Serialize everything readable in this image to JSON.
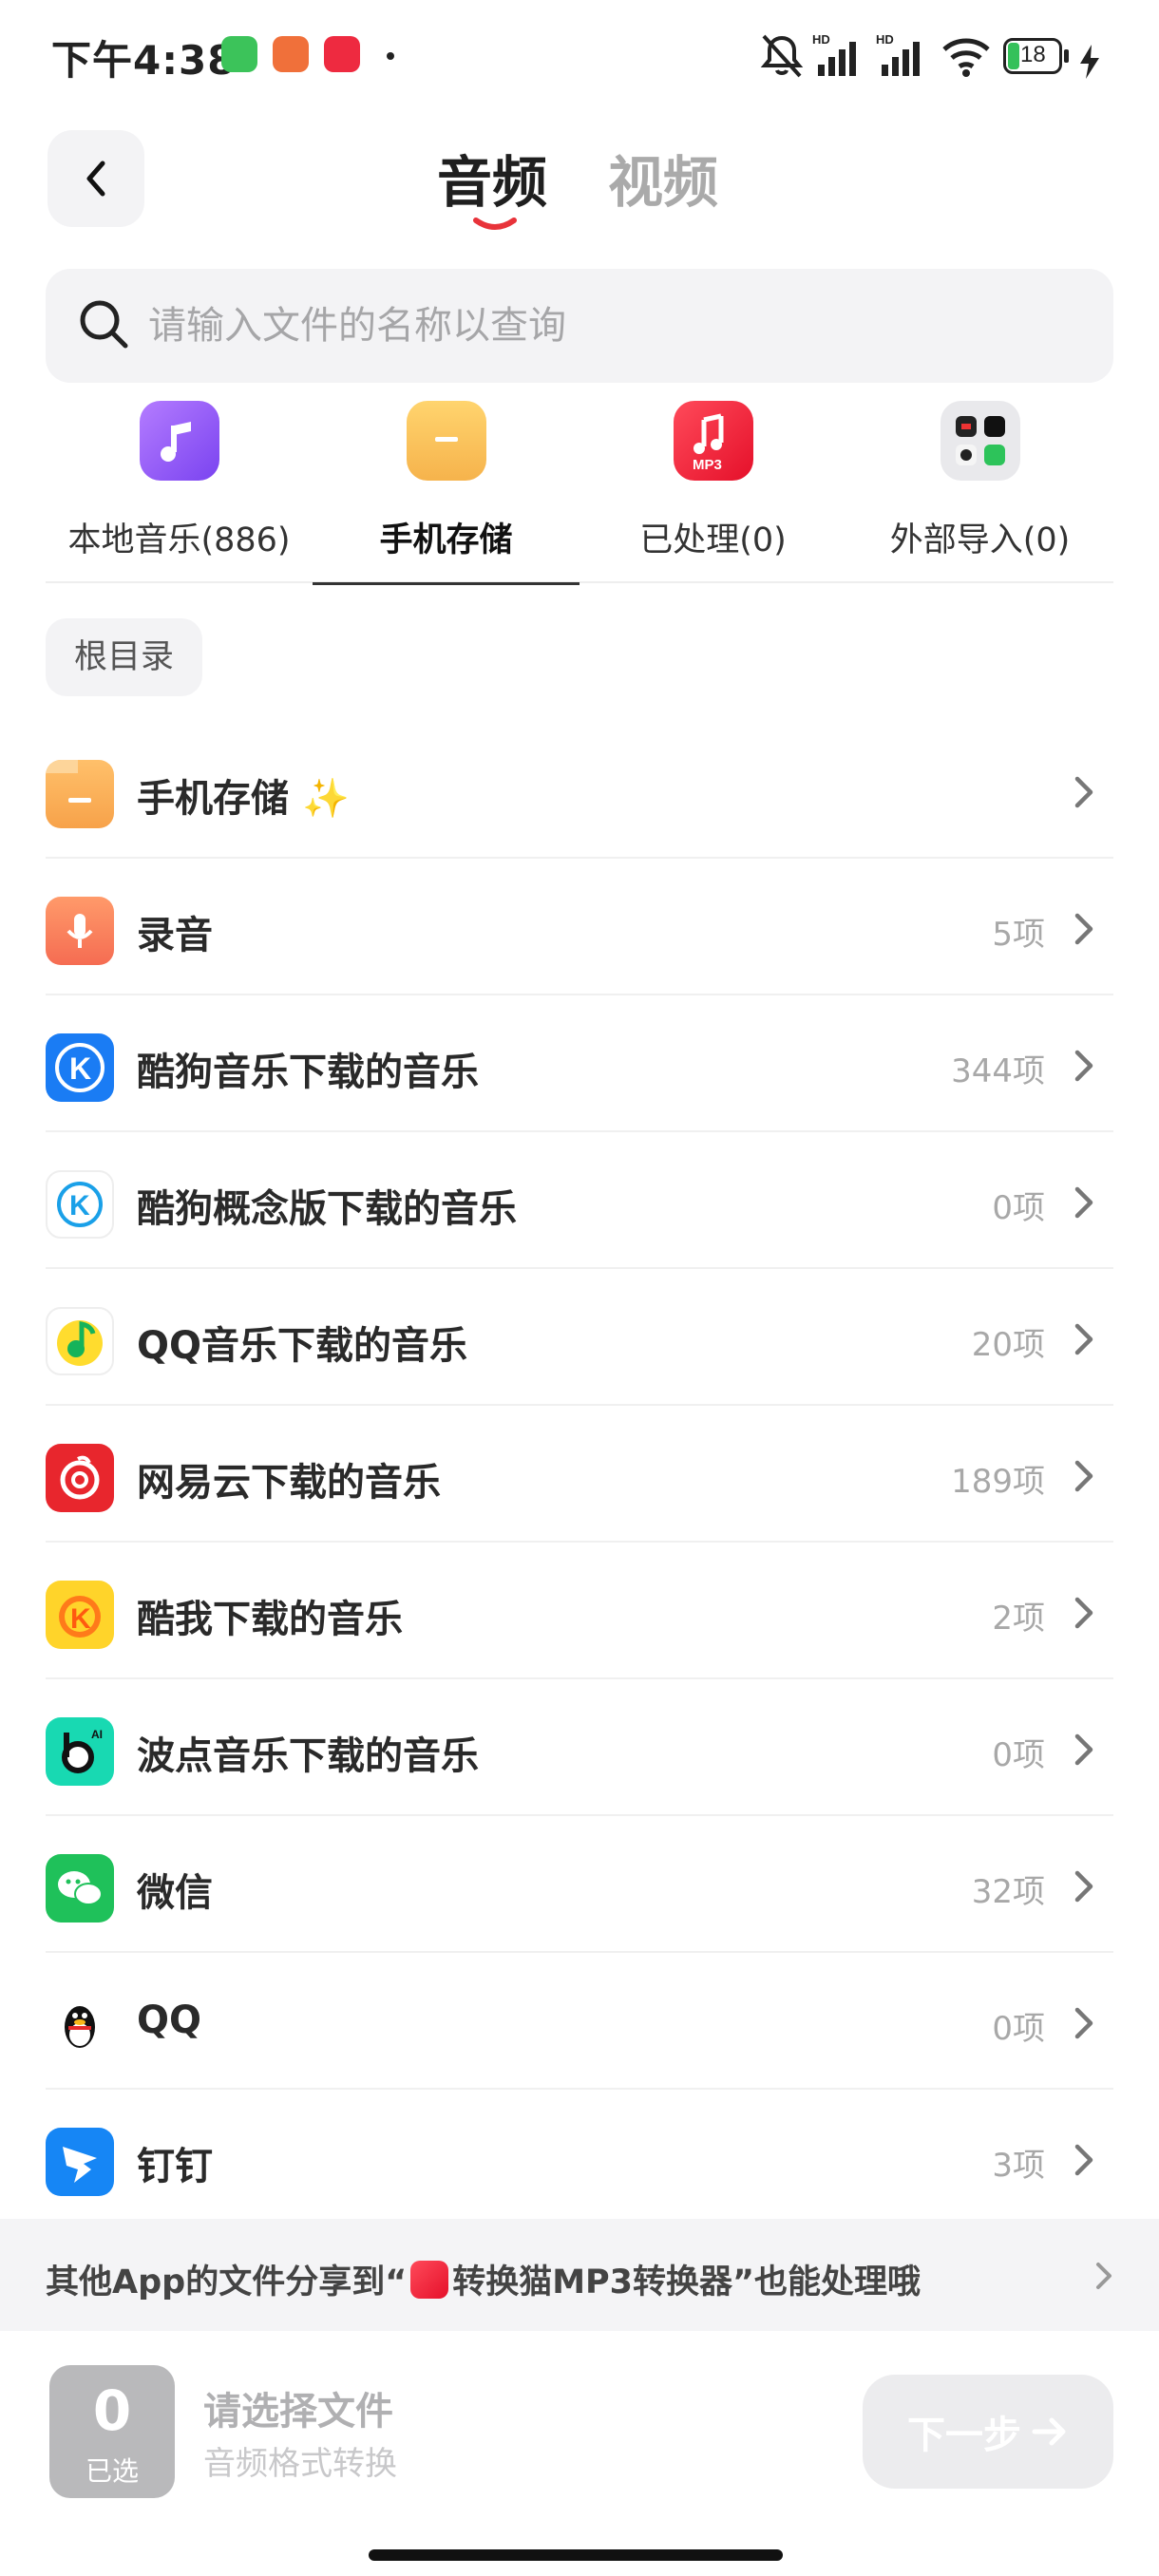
{
  "status_bar": {
    "time": "下午4:38",
    "battery": "18",
    "hd1": "HD",
    "hd2": "HD",
    "app_label_red": "小红书"
  },
  "header": {
    "tabs": [
      {
        "label": "音频",
        "active": true
      },
      {
        "label": "视频",
        "active": false
      }
    ],
    "accent_color": "#e8333a"
  },
  "search": {
    "placeholder": "请输入文件的名称以查询",
    "value": ""
  },
  "categories": [
    {
      "label": "本地音乐(886)",
      "icon": "music-note-icon",
      "active": false
    },
    {
      "label": "手机存储",
      "icon": "folder-icon",
      "active": true
    },
    {
      "label": "已处理(0)",
      "icon": "mp3-icon",
      "active": false
    },
    {
      "label": "外部导入(0)",
      "icon": "app-grid-icon",
      "active": false
    }
  ],
  "breadcrumb": "根目录",
  "list": [
    {
      "name": "手机存储",
      "badge": "✨",
      "count": "",
      "icon": "folder-icon"
    },
    {
      "name": "录音",
      "count": "5项",
      "icon": "microphone-icon"
    },
    {
      "name": "酷狗音乐下载的音乐",
      "count": "344项",
      "icon": "kugou-icon"
    },
    {
      "name": "酷狗概念版下载的音乐",
      "count": "0项",
      "icon": "kugou-concept-icon"
    },
    {
      "name": "QQ音乐下载的音乐",
      "count": "20项",
      "icon": "qq-music-icon"
    },
    {
      "name": "网易云下载的音乐",
      "count": "189项",
      "icon": "netease-icon"
    },
    {
      "name": "酷我下载的音乐",
      "count": "2项",
      "icon": "kuwo-icon"
    },
    {
      "name": "波点音乐下载的音乐",
      "count": "0项",
      "icon": "bodian-icon"
    },
    {
      "name": "微信",
      "count": "32项",
      "icon": "wechat-icon"
    },
    {
      "name": "QQ",
      "count": "0项",
      "icon": "qq-penguin-icon"
    },
    {
      "name": "钉钉",
      "count": "3项",
      "icon": "dingtalk-icon"
    }
  ],
  "share_banner": {
    "prefix": "其他App的文件分享到“",
    "app_name": "转换猫MP3转换器",
    "suffix": "”也能处理哦"
  },
  "bottom": {
    "selected_count": "0",
    "selected_label": "已选",
    "title": "请选择文件",
    "subtitle": "音频格式转换",
    "next_label": "下一步"
  }
}
